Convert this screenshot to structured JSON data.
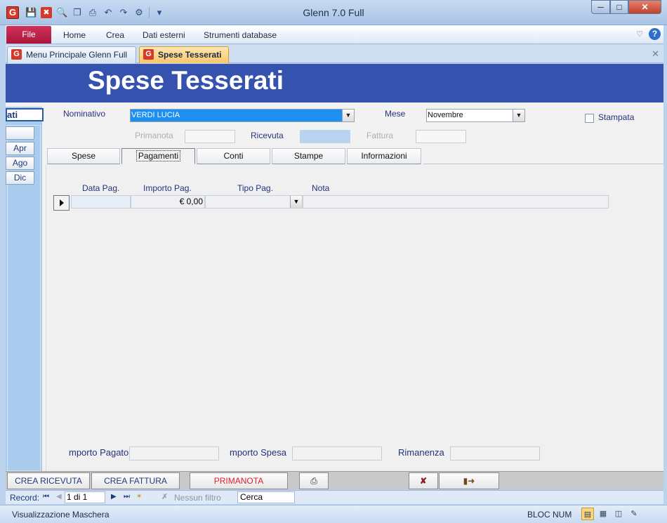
{
  "window": {
    "title": "Glenn 7.0 Full",
    "app_logo_letter": "G"
  },
  "ribbon": {
    "file_label": "File",
    "menu": [
      "Home",
      "Crea",
      "Dati esterni",
      "Strumenti database"
    ]
  },
  "doc_tabs": [
    {
      "label": "Menu Principale Glenn Full",
      "active": false
    },
    {
      "label": "Spese Tesserati",
      "active": true
    }
  ],
  "form": {
    "title": "Spese Tesserati",
    "left_nav": {
      "header": "ati",
      "buttons": [
        "",
        "Apr",
        "Ago",
        "Dic"
      ]
    },
    "nominativo": {
      "label": "Nominativo",
      "value": "VERDI LUCIA"
    },
    "mese": {
      "label": "Mese",
      "value": "Novembre"
    },
    "stampata": {
      "label": "Stampata",
      "checked": false
    },
    "primanota": {
      "label": "Primanota",
      "value": ""
    },
    "ricevuta": {
      "label": "Ricevuta",
      "value": ""
    },
    "fattura": {
      "label": "Fattura",
      "value": ""
    },
    "tabs": [
      {
        "label": "Spese",
        "active": false
      },
      {
        "label": "Pagamenti",
        "active": true
      },
      {
        "label": "Conti",
        "active": false
      },
      {
        "label": "Stampe",
        "active": false
      },
      {
        "label": "Informazioni",
        "active": false
      }
    ],
    "grid": {
      "columns": [
        "Data Pag.",
        "Importo Pag.",
        "Tipo Pag.",
        "Nota"
      ],
      "rows": [
        {
          "data_pag": "",
          "importo_pag": "€ 0,00",
          "tipo_pag": "",
          "nota": ""
        }
      ]
    },
    "totals": {
      "importo_pagato_label": "mporto Pagato",
      "importo_spesa_label": "mporto Spesa",
      "rimanenza_label": "Rimanenza"
    }
  },
  "action_bar": {
    "crea_ricevuta": "CREA RICEVUTA",
    "crea_fattura": "CREA FATTURA",
    "primanota": "PRIMANOTA",
    "primanota_color": "#e0202a"
  },
  "record_nav": {
    "label": "Record:",
    "position": "1 di 1",
    "filter": "Nessun filtro",
    "search": "Cerca"
  },
  "status_bar": {
    "left": "Visualizzazione Maschera",
    "right": "BLOC NUM"
  },
  "colors": {
    "header_band": "#3452ae",
    "selected_combo": "#1d8ff0",
    "label_text": "#25327a"
  }
}
